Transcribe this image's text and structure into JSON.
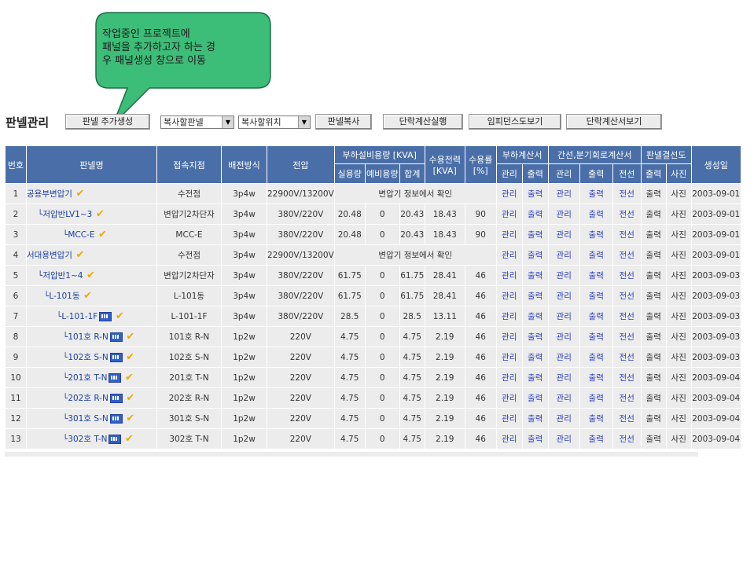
{
  "bubble": {
    "lines": [
      "작업중인 프로젝트에",
      "패널을 추가하고자 하는 경",
      "우 패널생성 창으로 이동"
    ],
    "color": "#3cbd78"
  },
  "toolbar": {
    "title": "판넬관리",
    "add_panel": "판넬 추가생성",
    "copy_panel_select": "복사할판넬",
    "copy_position_select": "복사할위치",
    "copy_panel": "판넬복사",
    "short_circuit_run": "단락계산실행",
    "impedance_map": "임피던스도보기",
    "short_circuit_report": "단락계산서보기"
  },
  "table": {
    "header_color": "#4a6ea8",
    "headers": {
      "no": "번호",
      "name": "판넬명",
      "connection": "접속지점",
      "wiring": "배전방식",
      "voltage": "전압",
      "load_capacity": "부하설비용량 [KVA]",
      "actual": "실용량",
      "spare": "예비용량",
      "sum": "합계",
      "demand_power": "수용전력",
      "demand_power_unit": "[KVA]",
      "demand_rate": "수용률",
      "demand_rate_unit": "[%]",
      "load_calc": "부하계산서",
      "feeder_calc": "간선,분기회로계산서",
      "panel_diagram": "판넬결선도",
      "manage": "관리",
      "output": "출력",
      "manage2": "관리",
      "output2": "출력",
      "wire": "전선",
      "output3": "출력",
      "photo": "사진",
      "created": "생성일"
    },
    "rows": [
      {
        "no": "1",
        "name": "공용부변압기",
        "icon": false,
        "conn": "수전점",
        "wiring": "3p4w",
        "voltage": "22900V/13200V",
        "merged": "변압기 정보에서 확인",
        "date": "2003-09-01"
      },
      {
        "no": "2",
        "name": "└저압반LV1~3",
        "icon": false,
        "conn": "변압기2차단자",
        "wiring": "3p4w",
        "voltage": "380V/220V",
        "actual": "20.48",
        "spare": "0",
        "sum": "20.43",
        "demand": "18.43",
        "rate": "90",
        "date": "2003-09-01"
      },
      {
        "no": "3",
        "name": "└MCC-E",
        "icon": false,
        "conn": "MCC-E",
        "wiring": "3p4w",
        "voltage": "380V/220V",
        "actual": "20.48",
        "spare": "0",
        "sum": "20.43",
        "demand": "18.43",
        "rate": "90",
        "date": "2003-09-01"
      },
      {
        "no": "4",
        "name": "서대용변압기",
        "icon": false,
        "conn": "수전점",
        "wiring": "3p4w",
        "voltage": "22900V/13200V",
        "merged": "변압기 정보에서 확인",
        "date": "2003-09-01"
      },
      {
        "no": "5",
        "name": "└저압반1~4",
        "icon": false,
        "conn": "변압기2차단자",
        "wiring": "3p4w",
        "voltage": "380V/220V",
        "actual": "61.75",
        "spare": "0",
        "sum": "61.75",
        "demand": "28.41",
        "rate": "46",
        "date": "2003-09-03"
      },
      {
        "no": "6",
        "name": "└L-101동",
        "icon": false,
        "conn": "L-101동",
        "wiring": "3p4w",
        "voltage": "380V/220V",
        "actual": "61.75",
        "spare": "0",
        "sum": "61.75",
        "demand": "28.41",
        "rate": "46",
        "date": "2003-09-03"
      },
      {
        "no": "7",
        "name": "└L-101-1F",
        "icon": true,
        "conn": "L-101-1F",
        "wiring": "3p4w",
        "voltage": "380V/220V",
        "actual": "28.5",
        "spare": "0",
        "sum": "28.5",
        "demand": "13.11",
        "rate": "46",
        "date": "2003-09-03"
      },
      {
        "no": "8",
        "name": "└101호 R-N",
        "icon": true,
        "conn": "101호 R-N",
        "wiring": "1p2w",
        "voltage": "220V",
        "actual": "4.75",
        "spare": "0",
        "sum": "4.75",
        "demand": "2.19",
        "rate": "46",
        "date": "2003-09-03"
      },
      {
        "no": "9",
        "name": "└102호 S-N",
        "icon": true,
        "conn": "102호 S-N",
        "wiring": "1p2w",
        "voltage": "220V",
        "actual": "4.75",
        "spare": "0",
        "sum": "4.75",
        "demand": "2.19",
        "rate": "46",
        "date": "2003-09-03"
      },
      {
        "no": "10",
        "name": "└201호 T-N",
        "icon": true,
        "conn": "201호 T-N",
        "wiring": "1p2w",
        "voltage": "220V",
        "actual": "4.75",
        "spare": "0",
        "sum": "4.75",
        "demand": "2.19",
        "rate": "46",
        "date": "2003-09-04"
      },
      {
        "no": "11",
        "name": "└202호 R-N",
        "icon": true,
        "conn": "202호 R-N",
        "wiring": "1p2w",
        "voltage": "220V",
        "actual": "4.75",
        "spare": "0",
        "sum": "4.75",
        "demand": "2.19",
        "rate": "46",
        "date": "2003-09-04"
      },
      {
        "no": "12",
        "name": "└301호 S-N",
        "icon": true,
        "conn": "301호 S-N",
        "wiring": "1p2w",
        "voltage": "220V",
        "actual": "4.75",
        "spare": "0",
        "sum": "4.75",
        "demand": "2.19",
        "rate": "46",
        "date": "2003-09-04"
      },
      {
        "no": "13",
        "name": "└302호 T-N",
        "icon": true,
        "conn": "302호 T-N",
        "wiring": "1p2w",
        "voltage": "220V",
        "actual": "4.75",
        "spare": "0",
        "sum": "4.75",
        "demand": "2.19",
        "rate": "46",
        "date": "2003-09-04"
      }
    ],
    "action_labels": {
      "manage": "관리",
      "output": "출력",
      "wire": "전선",
      "photo": "사진"
    }
  }
}
